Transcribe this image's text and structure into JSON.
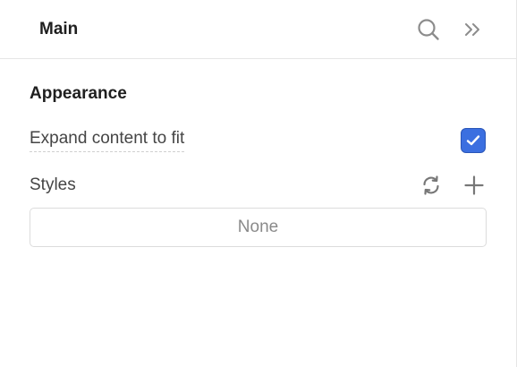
{
  "header": {
    "title": "Main",
    "search_icon": "search-icon",
    "collapse_icon": "double-chevron-right-icon"
  },
  "appearance": {
    "title": "Appearance",
    "expand_label": "Expand content to fit",
    "expand_checked": true
  },
  "styles": {
    "label": "Styles",
    "refresh_icon": "refresh-icon",
    "add_icon": "plus-icon",
    "value": "None"
  },
  "colors": {
    "accent": "#3b6fe0",
    "text": "#1f1f1f",
    "muted": "#8a8a8a",
    "border": "#dcdcdc"
  }
}
